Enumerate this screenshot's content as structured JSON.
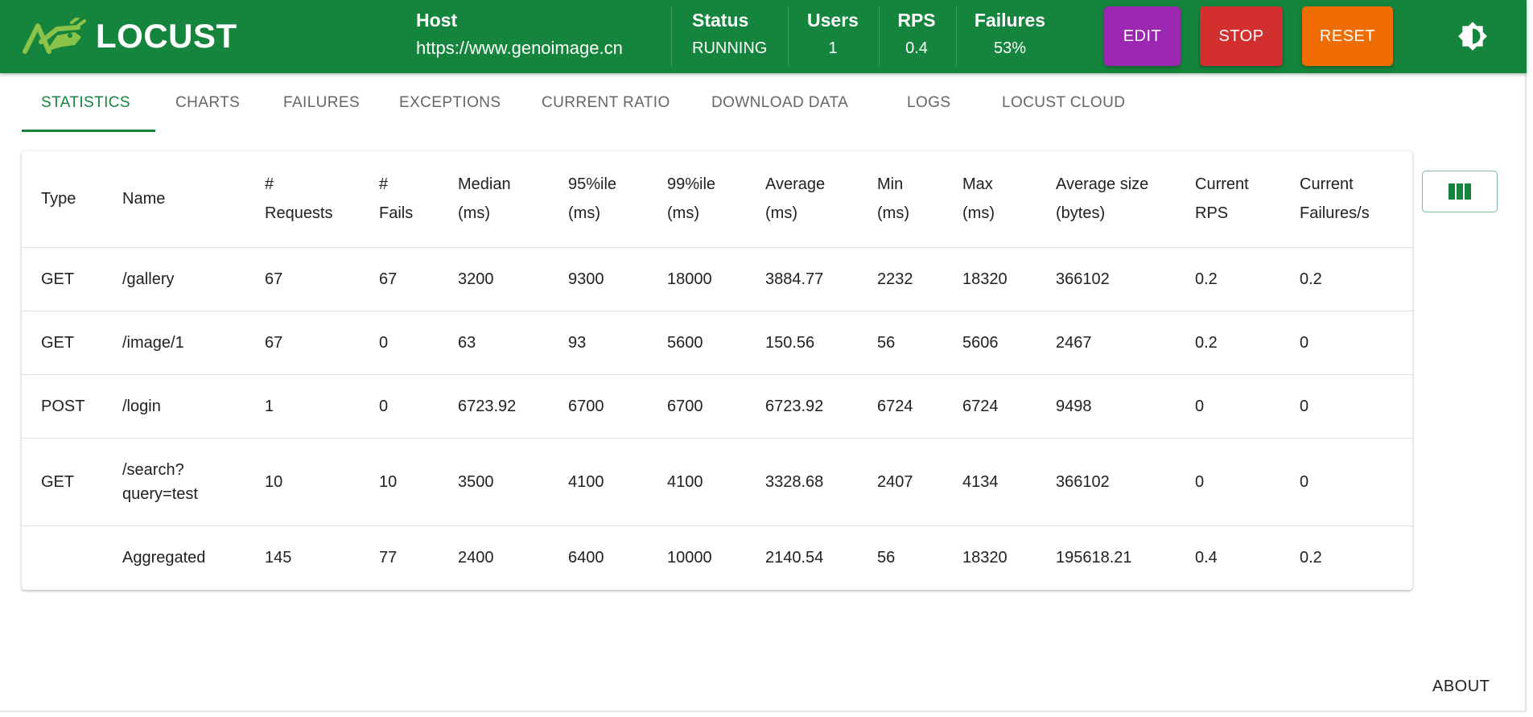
{
  "header": {
    "logo_text": "LOCUST",
    "host": {
      "label": "Host",
      "value": "https://www.genoimage.cn"
    },
    "status": {
      "label": "Status",
      "value": "RUNNING"
    },
    "users": {
      "label": "Users",
      "value": "1"
    },
    "rps": {
      "label": "RPS",
      "value": "0.4"
    },
    "failures": {
      "label": "Failures",
      "value": "53%"
    },
    "buttons": {
      "edit": "EDIT",
      "stop": "STOP",
      "reset": "RESET"
    },
    "colors": {
      "header_bg": "#15843c",
      "edit": "#9c27b0",
      "stop": "#d32f2f",
      "reset": "#ef6c00",
      "logo_mark": "#8bc34a"
    },
    "theme_icon": "brightness-icon"
  },
  "tabs": {
    "items": [
      {
        "label": "STATISTICS",
        "active": true
      },
      {
        "label": "CHARTS",
        "active": false
      },
      {
        "label": "FAILURES",
        "active": false
      },
      {
        "label": "EXCEPTIONS",
        "active": false
      },
      {
        "label": "CURRENT RATIO",
        "active": false
      },
      {
        "label": "DOWNLOAD DATA",
        "active": false
      },
      {
        "label": "LOGS",
        "active": false
      },
      {
        "label": "LOCUST CLOUD",
        "active": false
      }
    ]
  },
  "table": {
    "columns": [
      {
        "line1": "Type",
        "line2": ""
      },
      {
        "line1": "Name",
        "line2": ""
      },
      {
        "line1": "#",
        "line2": "Requests"
      },
      {
        "line1": "#",
        "line2": "Fails"
      },
      {
        "line1": "Median",
        "line2": "(ms)"
      },
      {
        "line1": "95%ile",
        "line2": "(ms)"
      },
      {
        "line1": "99%ile",
        "line2": "(ms)"
      },
      {
        "line1": "Average",
        "line2": "(ms)"
      },
      {
        "line1": "Min",
        "line2": "(ms)"
      },
      {
        "line1": "Max",
        "line2": "(ms)"
      },
      {
        "line1": "Average size",
        "line2": "(bytes)"
      },
      {
        "line1": "Current",
        "line2": "RPS"
      },
      {
        "line1": "Current",
        "line2": "Failures/s"
      }
    ],
    "rows": [
      {
        "type": "GET",
        "name_line1": "/gallery",
        "name_line2": "",
        "requests": "67",
        "fails": "67",
        "median": "3200",
        "p95": "9300",
        "p99": "18000",
        "average": "3884.77",
        "min": "2232",
        "max": "18320",
        "avg_size": "366102",
        "current_rps": "0.2",
        "current_failures": "0.2"
      },
      {
        "type": "GET",
        "name_line1": "/image/1",
        "name_line2": "",
        "requests": "67",
        "fails": "0",
        "median": "63",
        "p95": "93",
        "p99": "5600",
        "average": "150.56",
        "min": "56",
        "max": "5606",
        "avg_size": "2467",
        "current_rps": "0.2",
        "current_failures": "0"
      },
      {
        "type": "POST",
        "name_line1": "/login",
        "name_line2": "",
        "requests": "1",
        "fails": "0",
        "median": "6723.92",
        "p95": "6700",
        "p99": "6700",
        "average": "6723.92",
        "min": "6724",
        "max": "6724",
        "avg_size": "9498",
        "current_rps": "0",
        "current_failures": "0"
      },
      {
        "type": "GET",
        "name_line1": "/search?",
        "name_line2": "query=test",
        "requests": "10",
        "fails": "10",
        "median": "3500",
        "p95": "4100",
        "p99": "4100",
        "average": "3328.68",
        "min": "2407",
        "max": "4134",
        "avg_size": "366102",
        "current_rps": "0",
        "current_failures": "0"
      }
    ],
    "aggregated": {
      "type": "",
      "name": "Aggregated",
      "requests": "145",
      "fails": "77",
      "median": "2400",
      "p95": "6400",
      "p99": "10000",
      "average": "2140.54",
      "min": "56",
      "max": "18320",
      "avg_size": "195618.21",
      "current_rps": "0.4",
      "current_failures": "0.2"
    }
  },
  "column_picker_icon": "view-column-icon",
  "footer": {
    "about": "ABOUT"
  }
}
